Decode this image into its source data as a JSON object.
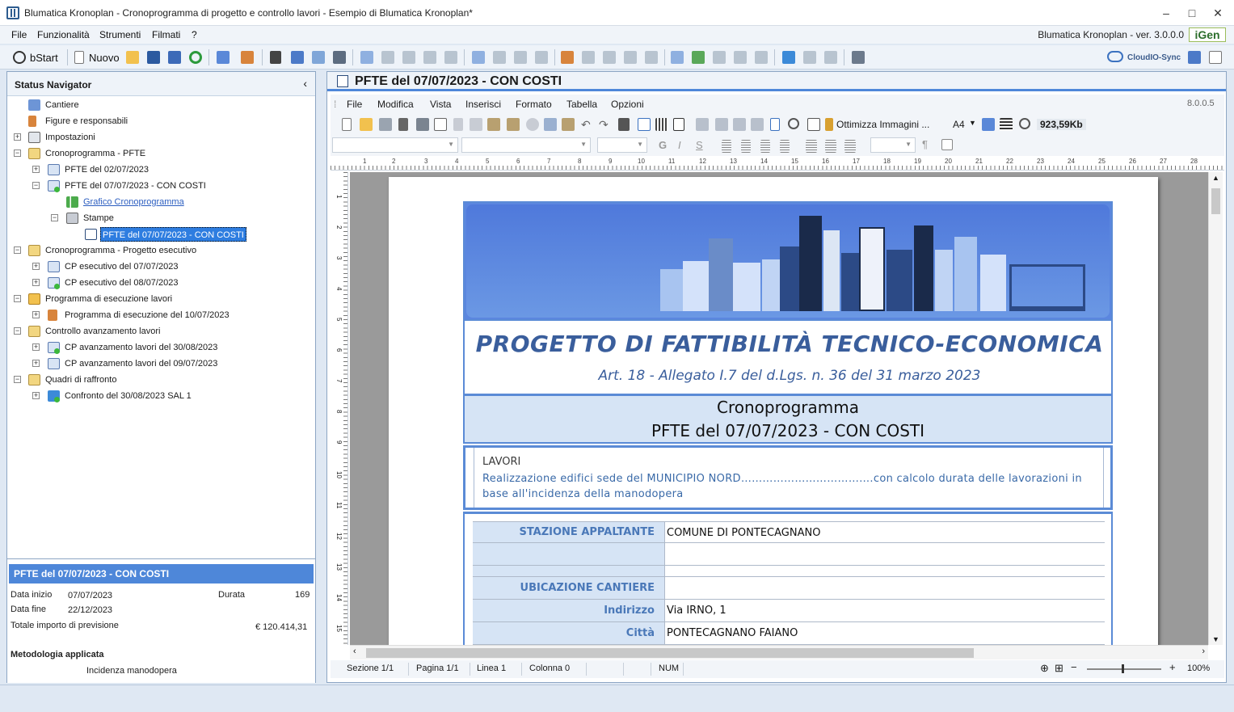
{
  "window": {
    "title": "Blumatica Kronoplan - Cronoprogramma di progetto e controllo lavori - Esempio di Blumatica Kronoplan*"
  },
  "menu": {
    "items": [
      "File",
      "Funzionalità",
      "Strumenti",
      "Filmati",
      "?"
    ],
    "version": "Blumatica Kronoplan - ver. 3.0.0.0",
    "gen_logo": "iGen"
  },
  "toolbar": {
    "bstart": "bStart",
    "nuovo": "Nuovo",
    "cloud": "CloudIO-Sync"
  },
  "navigator": {
    "title": "Status Navigator",
    "tree": [
      {
        "label": "Cantiere"
      },
      {
        "label": "Figure e responsabili"
      },
      {
        "label": "Impostazioni"
      },
      {
        "label": "Cronoprogramma - PFTE"
      },
      {
        "label": "PFTE  del 02/07/2023"
      },
      {
        "label": "PFTE  del 07/07/2023 - CON COSTI"
      },
      {
        "label": "Grafico Cronoprogramma"
      },
      {
        "label": "Stampe"
      },
      {
        "label": "PFTE  del 07/07/2023 - CON COSTI"
      },
      {
        "label": "Cronoprogramma - Progetto esecutivo"
      },
      {
        "label": "CP esecutivo del 07/07/2023"
      },
      {
        "label": "CP esecutivo del 08/07/2023"
      },
      {
        "label": "Programma di esecuzione lavori"
      },
      {
        "label": "Programma di esecuzione del 10/07/2023"
      },
      {
        "label": "Controllo avanzamento lavori"
      },
      {
        "label": "CP avanzamento lavori del 30/08/2023"
      },
      {
        "label": "CP avanzamento lavori del 09/07/2023"
      },
      {
        "label": "Quadri di raffronto"
      },
      {
        "label": "Confronto del 30/08/2023 SAL 1"
      }
    ]
  },
  "summary": {
    "title": "PFTE  del 07/07/2023 - CON COSTI",
    "data_inizio_label": "Data inizio",
    "data_inizio": "07/07/2023",
    "durata_label": "Durata",
    "durata": "169",
    "data_fine_label": "Data fine",
    "data_fine": "22/12/2023",
    "totale_label": "Totale importo di previsione",
    "totale": "€ 120.414,31",
    "metodologia_label": "Metodologia applicata",
    "metodologia": "Incidenza manodopera"
  },
  "document_panel": {
    "title": "PFTE  del 07/07/2023 - CON COSTI",
    "editor_menu": [
      "File",
      "Modifica",
      "Vista",
      "Inserisci",
      "Formato",
      "Tabella",
      "Opzioni"
    ],
    "editor_version": "8.0.0.5",
    "ottimizza": "Ottimizza Immagini ...",
    "paper": "A4",
    "size": "923,59Kb",
    "ruler_marks": [
      "1",
      "2",
      "3",
      "4",
      "5",
      "6",
      "7",
      "8",
      "9",
      "10",
      "11",
      "12",
      "13",
      "14",
      "15",
      "16",
      "17",
      "18",
      "19",
      "20",
      "21",
      "22",
      "23",
      "24",
      "25",
      "26",
      "27",
      "28"
    ],
    "vruler_marks": [
      "1",
      "2",
      "3",
      "4",
      "5",
      "6",
      "7",
      "8",
      "9",
      "10",
      "11",
      "12",
      "13",
      "14",
      "15"
    ]
  },
  "document": {
    "heading": "PROGETTO DI FATTIBILITÀ TECNICO-ECONOMICA",
    "subheading": "Art. 18 - Allegato I.7 del d.Lgs. n. 36 del 31 marzo 2023",
    "crono": "Cronoprogramma",
    "crono_sub": "PFTE  del 07/07/2023 - CON COSTI",
    "lavori_label": "LAVORI",
    "lavori_desc": "Realizzazione edifici sede del MUNICIPIO NORD……………………………….con calcolo durata delle lavorazioni in base all'incidenza della manodopera",
    "rows": [
      {
        "label": "STAZIONE APPALTANTE",
        "value": "COMUNE DI PONTECAGNANO"
      },
      {
        "label": "",
        "value": ""
      },
      {
        "label": "",
        "value": ""
      },
      {
        "label": "UBICAZIONE CANTIERE",
        "value": ""
      },
      {
        "label": "Indirizzo",
        "value": "Via IRNO, 1"
      },
      {
        "label": "Città",
        "value": "PONTECAGNANO FAIANO"
      }
    ]
  },
  "statusbar": {
    "sezione": "Sezione 1/1",
    "pagina": "Pagina 1/1",
    "linea": "Linea 1",
    "colonna": "Colonna 0",
    "num": "NUM",
    "zoom": "100%"
  },
  "colors": {
    "accent": "#4e87d9",
    "heading": "#3a5e9c",
    "label_bg": "#d6e4f5"
  }
}
